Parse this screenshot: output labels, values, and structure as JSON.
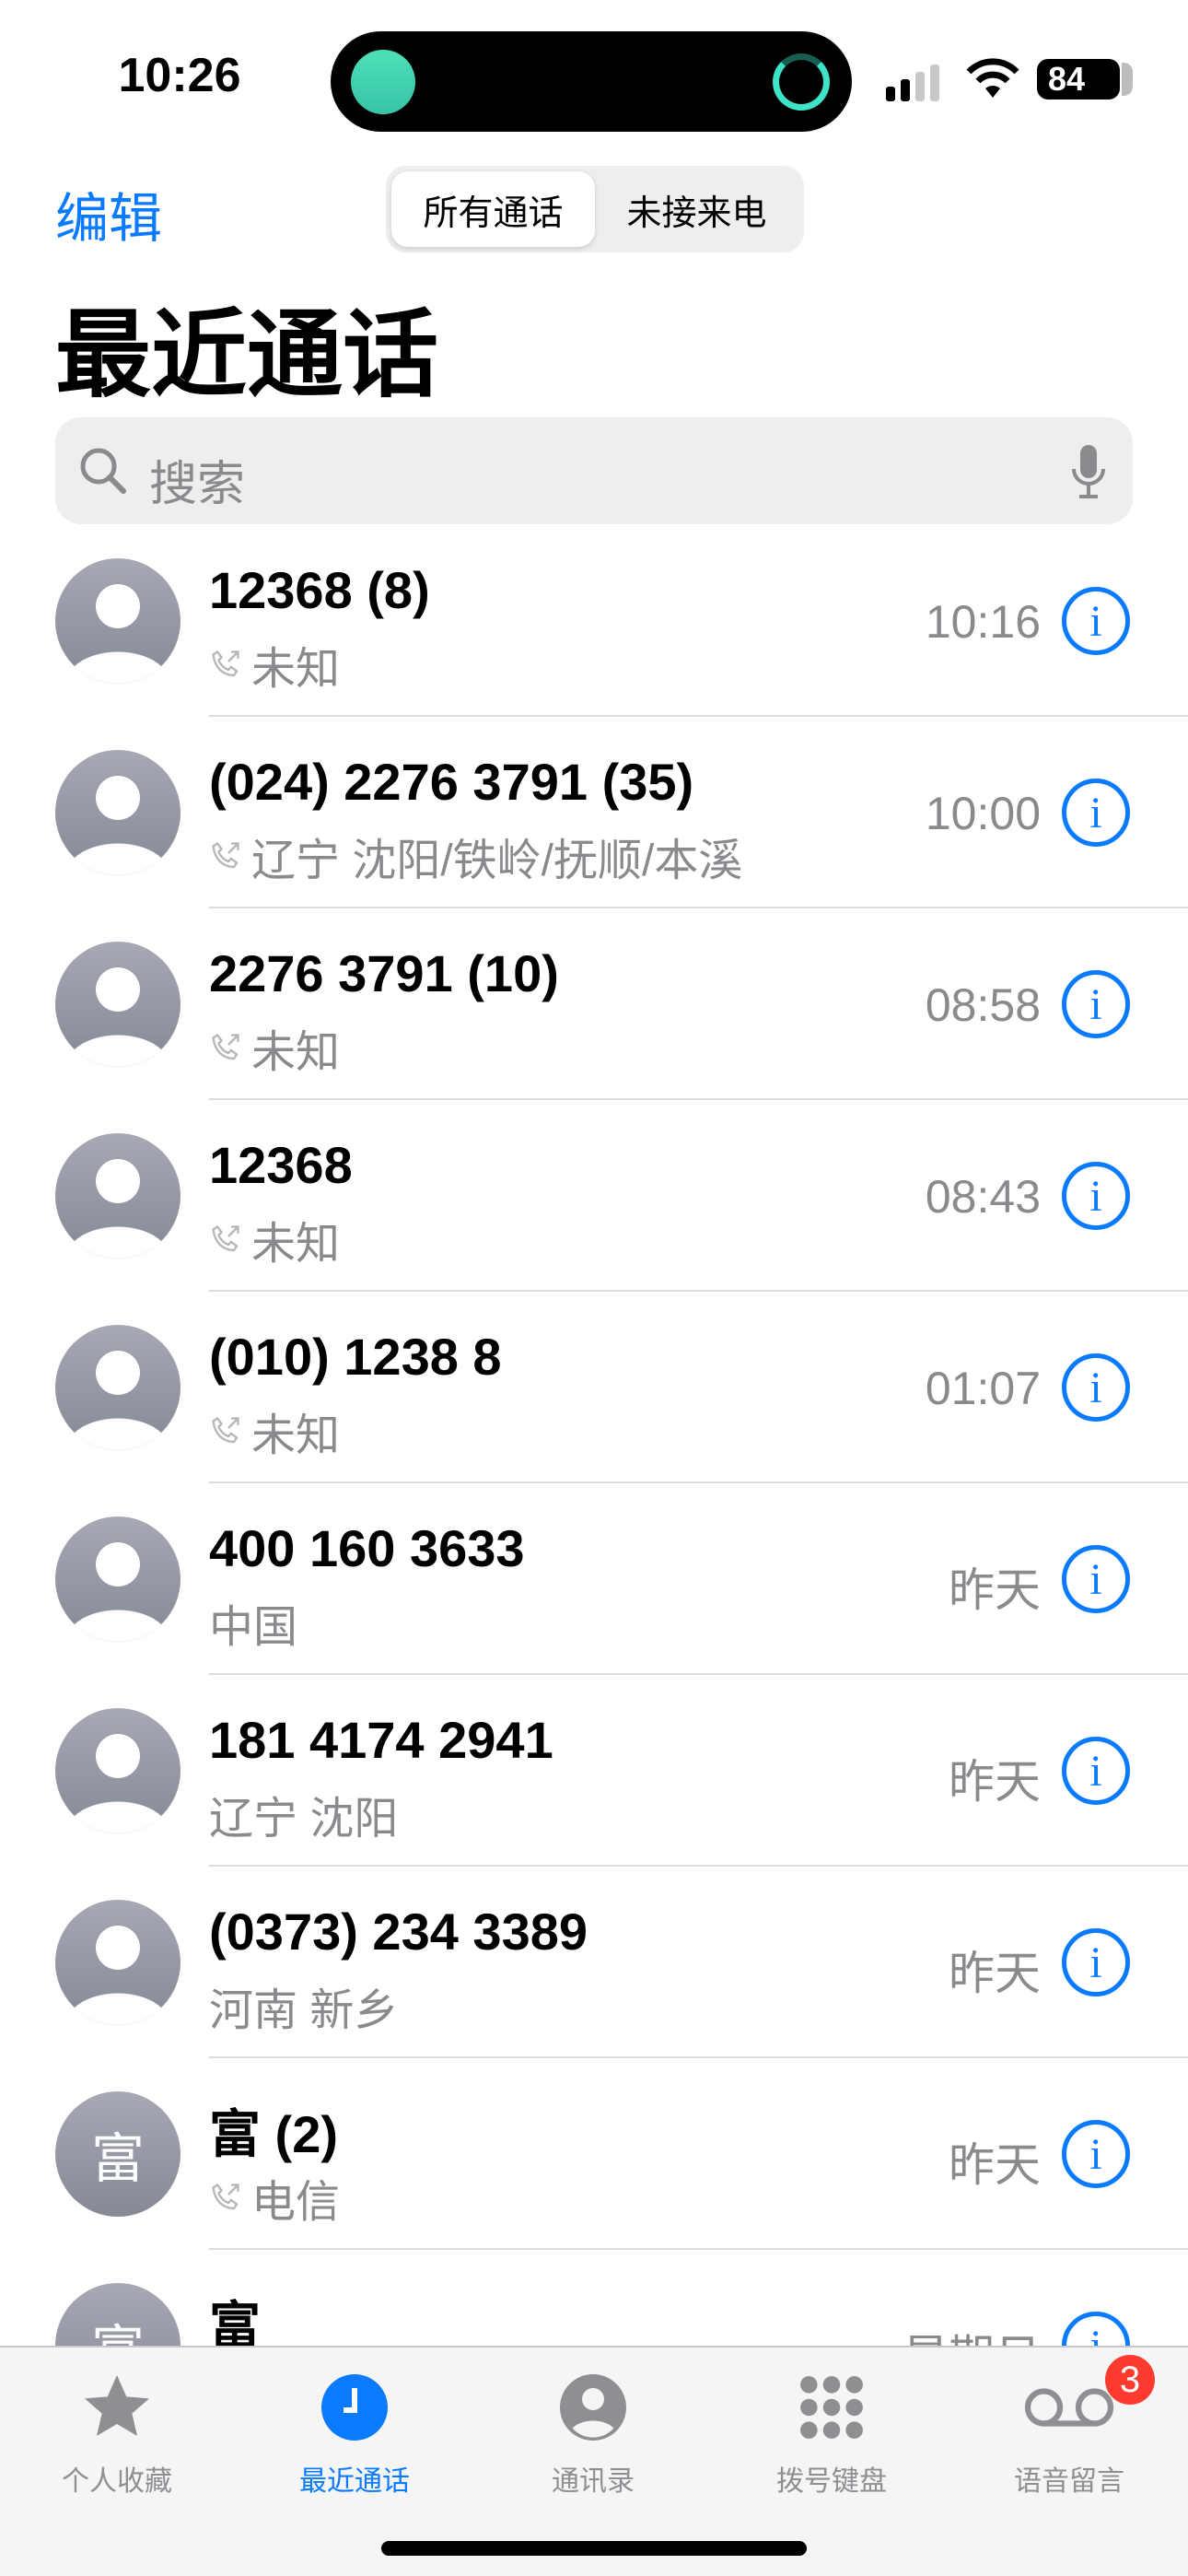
{
  "status": {
    "time": "10:26",
    "battery": "84"
  },
  "nav": {
    "edit": "编辑",
    "segments": [
      "所有通话",
      "未接来电"
    ],
    "selected_segment": 0,
    "title": "最近通话"
  },
  "search": {
    "placeholder": "搜索"
  },
  "calls": [
    {
      "name": "12368 (8)",
      "sub": "未知",
      "phone_icon": true,
      "time": "10:16"
    },
    {
      "name": "(024) 2276 3791 (35)",
      "sub": "辽宁 沈阳/铁岭/抚顺/本溪",
      "phone_icon": true,
      "time": "10:00"
    },
    {
      "name": "2276 3791 (10)",
      "sub": "未知",
      "phone_icon": true,
      "time": "08:58"
    },
    {
      "name": "12368",
      "sub": "未知",
      "phone_icon": true,
      "time": "08:43"
    },
    {
      "name": "(010) 1238 8",
      "sub": "未知",
      "phone_icon": true,
      "time": "01:07"
    },
    {
      "name": "400 160 3633",
      "sub": "中国",
      "phone_icon": false,
      "time": "昨天"
    },
    {
      "name": "181 4174 2941",
      "sub": "辽宁 沈阳",
      "phone_icon": false,
      "time": "昨天"
    },
    {
      "name": "(0373) 234 3389",
      "sub": "河南 新乡",
      "phone_icon": false,
      "time": "昨天"
    },
    {
      "name": "富 (2)",
      "sub": "电信",
      "phone_icon": true,
      "time": "昨天",
      "initial": "富"
    },
    {
      "name": "富",
      "sub": "",
      "phone_icon": false,
      "time": "星期日",
      "initial": "富"
    }
  ],
  "tabs": [
    {
      "label": "个人收藏",
      "icon": "star-icon"
    },
    {
      "label": "最近通话",
      "icon": "clock-icon",
      "active": true
    },
    {
      "label": "通讯录",
      "icon": "person-circle-icon"
    },
    {
      "label": "拨号键盘",
      "icon": "keypad-icon"
    },
    {
      "label": "语音留言",
      "icon": "voicemail-icon",
      "badge": "3"
    }
  ],
  "colors": {
    "accent": "#0a7aff",
    "badge": "#ff3b30",
    "secondary_text": "#8a8a8e"
  }
}
